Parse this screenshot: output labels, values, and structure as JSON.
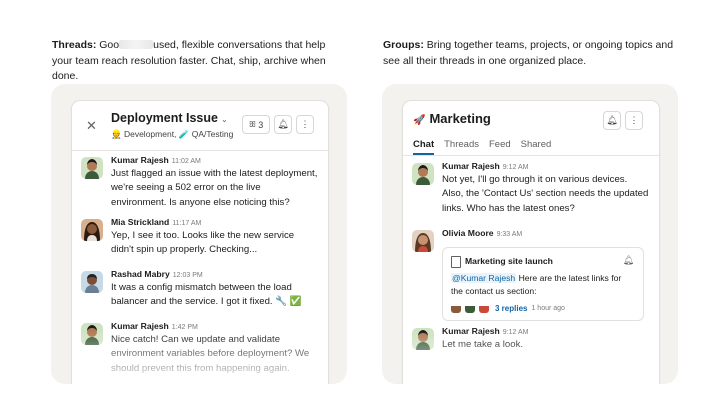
{
  "captions": {
    "threads_title": "Threads:",
    "threads_text_a": " Goo",
    "threads_text_b": "used, flexible conversations that help your team reach resolution faster. Chat, ship, archive when done.",
    "groups_title": "Groups:",
    "groups_text": " Bring together teams, projects, or ongoing topics and see all their threads in one organized place."
  },
  "thread_panel": {
    "title": "Deployment Issue",
    "sub_a": "Development,",
    "sub_b": "QA/Testing",
    "member_count": "3",
    "messages": [
      {
        "name": "Kumar Rajesh",
        "time": "11:02 AM",
        "text": "Just flagged an issue with the latest deployment, we're seeing a 502 error on the live environment. Is anyone else noticing this?"
      },
      {
        "name": "Mia Strickland",
        "time": "11:17 AM",
        "text": "Yep, I see it too. Looks like the new service didn't spin up properly. Checking..."
      },
      {
        "name": "Rashad Mabry",
        "time": "12:03 PM",
        "text": "It was a config mismatch between the load balancer and the service. I got it fixed. 🔧 ✅"
      },
      {
        "name": "Kumar Rajesh",
        "time": "1:42 PM",
        "text": "Nice catch! Can we update and validate environment variables before deployment? We should prevent this from happening again."
      }
    ]
  },
  "group_panel": {
    "title": "Marketing",
    "tabs": [
      "Chat",
      "Threads",
      "Feed",
      "Shared"
    ],
    "messages": [
      {
        "name": "Kumar Rajesh",
        "time": "9:12 AM",
        "text": "Not yet, I'll go through it on various devices. Also, the 'Contact Us' section needs the updated links. Who has the latest ones?"
      },
      {
        "name": "Olivia Moore",
        "time": "9:33 AM",
        "text": ""
      },
      {
        "name": "Kumar Rajesh",
        "time": "9:12 AM",
        "text": "Let me take a look."
      }
    ],
    "thread_card": {
      "title": "Marketing site launch",
      "mention": "@Kumar Rajesh",
      "text": " Here are the latest links for the contact us section:",
      "replies": "3 replies",
      "ago": "1 hour ago"
    }
  },
  "colors": {
    "accent": "#1264a3",
    "stage": "#f4f2ef"
  }
}
